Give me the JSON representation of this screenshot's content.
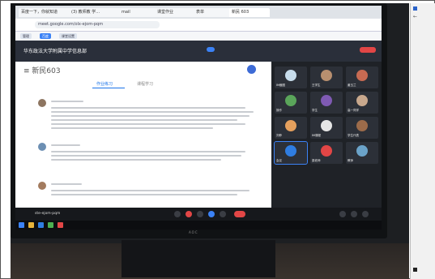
{
  "browser": {
    "tabs": [
      {
        "label": "百度一下，你就知道"
      },
      {
        "label": "(3) 教师教 学..."
      },
      {
        "label": "mail"
      },
      {
        "label": "课堂作业"
      },
      {
        "label": "表单"
      },
      {
        "label": "新民 603"
      }
    ],
    "url": "meet.google.com/olx-ejom-pqm",
    "bookmarks": [
      "管理",
      "百度",
      "课堂设置"
    ]
  },
  "meeting": {
    "title_left": "华东政法大学附属中学信息部",
    "title_right": "需要开课题研究报告",
    "code_label": "ste-ejom-pqm"
  },
  "document": {
    "title": "≡ 新民603",
    "tab_active": "作业练习",
    "tab_inactive": "课程学习"
  },
  "gallery": {
    "participants": [
      {
        "name": "IM截图",
        "color": "#c7dceb"
      },
      {
        "name": "王学生",
        "color": "#b88f6f"
      },
      {
        "name": "姜玉兰",
        "color": "#c76a52"
      },
      {
        "name": "操作",
        "color": "#5aa55a"
      },
      {
        "name": "学生",
        "color": "#7f5ab3"
      },
      {
        "name": "高一同学",
        "color": "#c8a88d"
      },
      {
        "name": "刘菲",
        "color": "#e5a05d"
      },
      {
        "name": "IM课程",
        "color": "#e6e6e6"
      },
      {
        "name": "学生代表",
        "color": "#9c6b4a"
      },
      {
        "name": "会议",
        "color": "#2f7de1"
      },
      {
        "name": "梁老师",
        "color": "#e24646"
      },
      {
        "name": "教师",
        "color": "#6ba3c9"
      }
    ],
    "accent": "#3b82f6",
    "alert": "#e24646"
  },
  "monitor": {
    "brand": "AOC"
  }
}
